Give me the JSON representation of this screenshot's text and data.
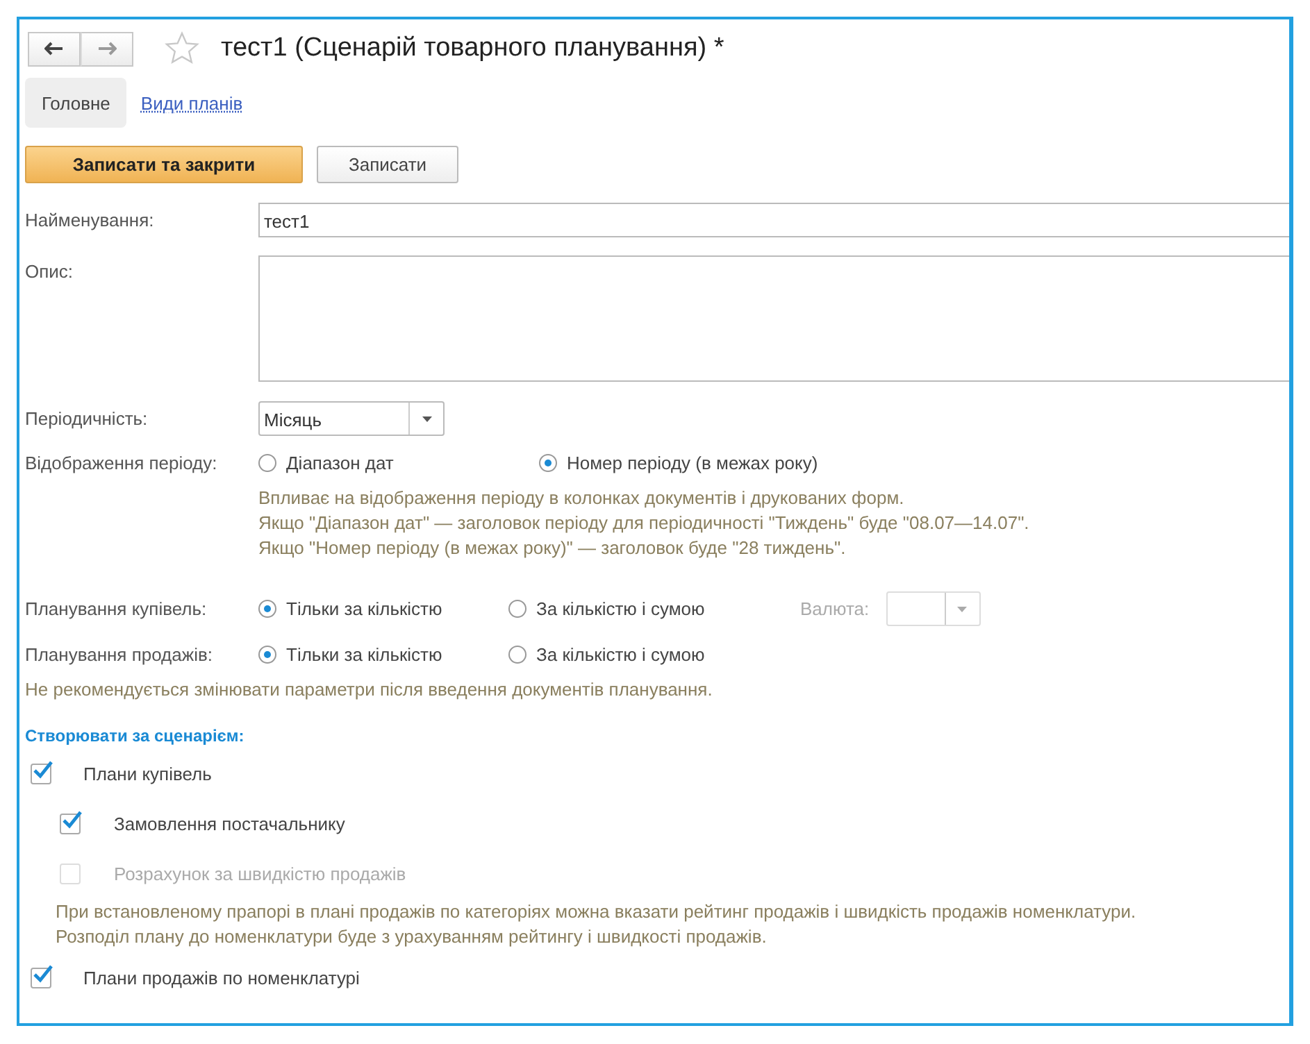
{
  "window": {
    "title": "тест1 (Сценарій товарного планування) *"
  },
  "tabs": [
    {
      "label": "Головне",
      "selected": true
    },
    {
      "label": "Види планів",
      "selected": false
    }
  ],
  "buttons": [
    {
      "label": "Записати та закрити",
      "kind": "primary"
    },
    {
      "label": "Записати",
      "kind": "default"
    }
  ],
  "name_field": {
    "label": "Найменування:",
    "value": "тест1"
  },
  "description_field": {
    "label": "Опис:"
  },
  "periodicity": {
    "label": "Періодичність:",
    "value": "Місяць"
  },
  "period_display": {
    "label": "Відображення періоду:",
    "options": [
      {
        "label": "Діапазон дат",
        "selected": false
      },
      {
        "label": "Номер періоду (в межах року)",
        "selected": true
      }
    ],
    "hint_lines": [
      "Впливає на відображення періоду в колонках документів і друкованих форм.",
      "Якщо \"Діапазон дат\" — заголовок періоду для періодичності \"Тиждень\" буде \"08.07—14.07\".",
      "Якщо \"Номер періоду (в межах року)\" — заголовок буде \"28 тиждень\"."
    ]
  },
  "purchase_planning": {
    "label": "Планування купівель:",
    "options": [
      {
        "label": "Тільки за кількістю",
        "selected": true
      },
      {
        "label": "За кількістю і сумою",
        "selected": false
      }
    ],
    "currency": {
      "label": "Валюта:",
      "disabled": true
    }
  },
  "sales_planning": {
    "label": "Планування продажів:",
    "options": [
      {
        "label": "Тільки за кількістю",
        "selected": true
      },
      {
        "label": "За кількістю і сумою",
        "selected": false
      }
    ]
  },
  "warning": "Не рекомендується змінювати параметри після введення документів планування.",
  "section_title": "Створювати за сценарієм:",
  "plans": [
    {
      "label": "Плани купівель",
      "checked": true,
      "children": [
        {
          "label": "Замовлення постачальнику",
          "checked": true,
          "disabled": false
        },
        {
          "label": "Розрахунок за швидкістю продажів",
          "checked": false,
          "disabled": true
        }
      ],
      "note_lines": [
        "При встановленому прапорі в плані продажів по категоріях можна вказати рейтинг продажів і швидкість продажів номенклатури.",
        "Розподіл плану до номенклатури буде з урахуванням рейтингу і швидкості продажів."
      ]
    },
    {
      "label": "Плани продажів по номенклатурі",
      "checked": true
    }
  ]
}
